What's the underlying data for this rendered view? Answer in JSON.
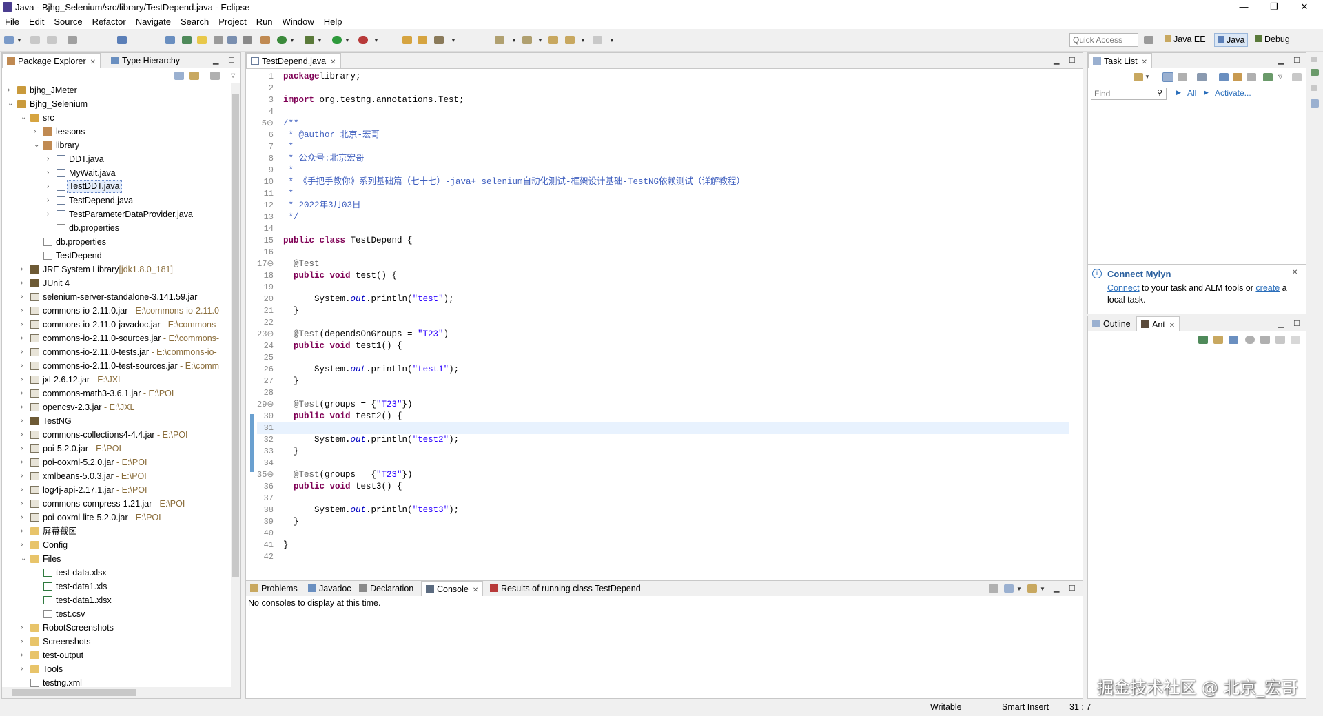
{
  "window": {
    "title": "Java - Bjhg_Selenium/src/library/TestDepend.java - Eclipse",
    "minimize": "—",
    "maximize": "❐",
    "close": "✕"
  },
  "menu": [
    "File",
    "Edit",
    "Source",
    "Refactor",
    "Navigate",
    "Search",
    "Project",
    "Run",
    "Window",
    "Help"
  ],
  "toolbar": {
    "quick_access": "Quick Access",
    "perspectives": [
      "Java EE",
      "Java",
      "Debug"
    ]
  },
  "package_explorer": {
    "tabs": [
      "Package Explorer",
      "Type Hierarchy"
    ],
    "items": [
      {
        "label": "bjhg_JMeter",
        "sub": "",
        "icon": "proj",
        "depth": 0,
        "tw": "›"
      },
      {
        "label": "Bjhg_Selenium",
        "sub": "",
        "icon": "proj",
        "depth": 0,
        "tw": "⌄"
      },
      {
        "label": "src",
        "sub": "",
        "icon": "src",
        "depth": 1,
        "tw": "⌄"
      },
      {
        "label": "lessons",
        "sub": "",
        "icon": "pkg",
        "depth": 2,
        "tw": "›"
      },
      {
        "label": "library",
        "sub": "",
        "icon": "pkg",
        "depth": 2,
        "tw": "⌄"
      },
      {
        "label": "DDT.java",
        "sub": "",
        "icon": "java",
        "depth": 3,
        "tw": "›"
      },
      {
        "label": "MyWait.java",
        "sub": "",
        "icon": "java",
        "depth": 3,
        "tw": "›"
      },
      {
        "label": "TestDDT.java",
        "sub": "",
        "icon": "java",
        "depth": 3,
        "tw": "›",
        "selected": true
      },
      {
        "label": "TestDepend.java",
        "sub": "",
        "icon": "java",
        "depth": 3,
        "tw": "›"
      },
      {
        "label": "TestParameterDataProvider.java",
        "sub": "",
        "icon": "java",
        "depth": 3,
        "tw": "›"
      },
      {
        "label": "db.properties",
        "sub": "",
        "icon": "file",
        "depth": 3,
        "tw": ""
      },
      {
        "label": "db.properties",
        "sub": "",
        "icon": "file",
        "depth": 2,
        "tw": ""
      },
      {
        "label": "TestDepend",
        "sub": "",
        "icon": "file",
        "depth": 2,
        "tw": ""
      },
      {
        "label": "JRE System Library",
        "sub": "[jdk1.8.0_181]",
        "icon": "lib",
        "depth": 1,
        "tw": "›"
      },
      {
        "label": "JUnit 4",
        "sub": "",
        "icon": "lib",
        "depth": 1,
        "tw": "›"
      },
      {
        "label": "selenium-server-standalone-3.141.59.jar",
        "sub": "",
        "icon": "jar",
        "depth": 1,
        "tw": "›"
      },
      {
        "label": "commons-io-2.11.0.jar",
        "sub": " - E:\\commons-io-2.11.0",
        "icon": "jar",
        "depth": 1,
        "tw": "›"
      },
      {
        "label": "commons-io-2.11.0-javadoc.jar",
        "sub": " - E:\\commons-",
        "icon": "jar",
        "depth": 1,
        "tw": "›"
      },
      {
        "label": "commons-io-2.11.0-sources.jar",
        "sub": " - E:\\commons-",
        "icon": "jar",
        "depth": 1,
        "tw": "›"
      },
      {
        "label": "commons-io-2.11.0-tests.jar",
        "sub": " - E:\\commons-io-",
        "icon": "jar",
        "depth": 1,
        "tw": "›"
      },
      {
        "label": "commons-io-2.11.0-test-sources.jar",
        "sub": " - E:\\comm",
        "icon": "jar",
        "depth": 1,
        "tw": "›"
      },
      {
        "label": "jxl-2.6.12.jar",
        "sub": " - E:\\JXL",
        "icon": "jar",
        "depth": 1,
        "tw": "›"
      },
      {
        "label": "commons-math3-3.6.1.jar",
        "sub": " - E:\\POI",
        "icon": "jar",
        "depth": 1,
        "tw": "›"
      },
      {
        "label": "opencsv-2.3.jar",
        "sub": " - E:\\JXL",
        "icon": "jar",
        "depth": 1,
        "tw": "›"
      },
      {
        "label": "TestNG",
        "sub": "",
        "icon": "lib",
        "depth": 1,
        "tw": "›"
      },
      {
        "label": "commons-collections4-4.4.jar",
        "sub": " - E:\\POI",
        "icon": "jar",
        "depth": 1,
        "tw": "›"
      },
      {
        "label": "poi-5.2.0.jar",
        "sub": " - E:\\POI",
        "icon": "jar",
        "depth": 1,
        "tw": "›"
      },
      {
        "label": "poi-ooxml-5.2.0.jar",
        "sub": " - E:\\POI",
        "icon": "jar",
        "depth": 1,
        "tw": "›"
      },
      {
        "label": "xmlbeans-5.0.3.jar",
        "sub": " - E:\\POI",
        "icon": "jar",
        "depth": 1,
        "tw": "›"
      },
      {
        "label": "log4j-api-2.17.1.jar",
        "sub": " - E:\\POI",
        "icon": "jar",
        "depth": 1,
        "tw": "›"
      },
      {
        "label": "commons-compress-1.21.jar",
        "sub": " - E:\\POI",
        "icon": "jar",
        "depth": 1,
        "tw": "›"
      },
      {
        "label": "poi-ooxml-lite-5.2.0.jar",
        "sub": " - E:\\POI",
        "icon": "jar",
        "depth": 1,
        "tw": "›"
      },
      {
        "label": "屏幕截图",
        "sub": "",
        "icon": "folder",
        "depth": 1,
        "tw": "›"
      },
      {
        "label": "Config",
        "sub": "",
        "icon": "folder",
        "depth": 1,
        "tw": "›"
      },
      {
        "label": "Files",
        "sub": "",
        "icon": "folder",
        "depth": 1,
        "tw": "⌄"
      },
      {
        "label": "test-data.xlsx",
        "sub": "",
        "icon": "xls",
        "depth": 2,
        "tw": ""
      },
      {
        "label": "test-data1.xls",
        "sub": "",
        "icon": "xls",
        "depth": 2,
        "tw": ""
      },
      {
        "label": "test-data1.xlsx",
        "sub": "",
        "icon": "xls",
        "depth": 2,
        "tw": ""
      },
      {
        "label": "test.csv",
        "sub": "",
        "icon": "file",
        "depth": 2,
        "tw": ""
      },
      {
        "label": "RobotScreenshots",
        "sub": "",
        "icon": "folder",
        "depth": 1,
        "tw": "›"
      },
      {
        "label": "Screenshots",
        "sub": "",
        "icon": "folder",
        "depth": 1,
        "tw": "›"
      },
      {
        "label": "test-output",
        "sub": "",
        "icon": "folder",
        "depth": 1,
        "tw": "›"
      },
      {
        "label": "Tools",
        "sub": "",
        "icon": "folder",
        "depth": 1,
        "tw": "›"
      },
      {
        "label": "testng.xml",
        "sub": "",
        "icon": "file",
        "depth": 1,
        "tw": ""
      }
    ]
  },
  "editor": {
    "tab": "TestDepend.java",
    "lines": [
      {
        "n": "1",
        "t": [
          [
            "kw",
            "package"
          ],
          [
            "",
            "library;"
          ]
        ]
      },
      {
        "n": "2",
        "t": []
      },
      {
        "n": "3",
        "t": [
          [
            "kw",
            "import"
          ],
          [
            "",
            " org.testng.annotations.Test;"
          ]
        ]
      },
      {
        "n": "4",
        "t": []
      },
      {
        "n": "5⊖",
        "t": [
          [
            "cm",
            "/**"
          ]
        ]
      },
      {
        "n": "6",
        "t": [
          [
            "cm",
            " * @author 北京-宏哥"
          ]
        ]
      },
      {
        "n": "7",
        "t": [
          [
            "cm",
            " *"
          ]
        ]
      },
      {
        "n": "8",
        "t": [
          [
            "cm",
            " * 公众号:北京宏哥"
          ]
        ]
      },
      {
        "n": "9",
        "t": [
          [
            "cm",
            " *"
          ]
        ]
      },
      {
        "n": "10",
        "t": [
          [
            "cm",
            " * 《手把手教你》系列基础篇（七十七）-java+ selenium自动化测试-框架设计基础-TestNG依赖测试（详解教程）"
          ]
        ]
      },
      {
        "n": "11",
        "t": [
          [
            "cm",
            " *"
          ]
        ]
      },
      {
        "n": "12",
        "t": [
          [
            "cm",
            " * 2022年3月03日"
          ]
        ]
      },
      {
        "n": "13",
        "t": [
          [
            "cm",
            " */"
          ]
        ]
      },
      {
        "n": "14",
        "t": []
      },
      {
        "n": "15",
        "t": [
          [
            "kw",
            "public class"
          ],
          [
            "",
            " TestDepend {"
          ]
        ]
      },
      {
        "n": "16",
        "t": []
      },
      {
        "n": "17⊖",
        "t": [
          [
            "an",
            "  @Test"
          ]
        ]
      },
      {
        "n": "18",
        "t": [
          [
            "kw",
            "  public void"
          ],
          [
            "",
            " test() {"
          ]
        ]
      },
      {
        "n": "19",
        "t": []
      },
      {
        "n": "20",
        "t": [
          [
            "",
            "      System."
          ],
          [
            "fd",
            "out"
          ],
          [
            "",
            ".println("
          ],
          [
            "st",
            "\"test\""
          ],
          [
            "",
            ");"
          ]
        ]
      },
      {
        "n": "21",
        "t": [
          [
            "",
            "  }"
          ]
        ]
      },
      {
        "n": "22",
        "t": []
      },
      {
        "n": "23⊖",
        "t": [
          [
            "an",
            "  @Test"
          ],
          [
            "",
            "(dependsOnGroups = "
          ],
          [
            "st",
            "\"T23\""
          ],
          [
            "",
            ")"
          ]
        ]
      },
      {
        "n": "24",
        "t": [
          [
            "kw",
            "  public void"
          ],
          [
            "",
            " test1() {"
          ]
        ]
      },
      {
        "n": "25",
        "t": []
      },
      {
        "n": "26",
        "t": [
          [
            "",
            "      System."
          ],
          [
            "fd",
            "out"
          ],
          [
            "",
            ".println("
          ],
          [
            "st",
            "\"test1\""
          ],
          [
            "",
            ");"
          ]
        ]
      },
      {
        "n": "27",
        "t": [
          [
            "",
            "  }"
          ]
        ]
      },
      {
        "n": "28",
        "t": []
      },
      {
        "n": "29⊖",
        "t": [
          [
            "an",
            "  @Test"
          ],
          [
            "",
            "(groups = {"
          ],
          [
            "st",
            "\"T23\""
          ],
          [
            "",
            "})"
          ]
        ]
      },
      {
        "n": "30",
        "t": [
          [
            "kw",
            "  public void"
          ],
          [
            "",
            " test2() {"
          ]
        ]
      },
      {
        "n": "31",
        "t": [],
        "current": true
      },
      {
        "n": "32",
        "t": [
          [
            "",
            "      System."
          ],
          [
            "fd",
            "out"
          ],
          [
            "",
            ".println("
          ],
          [
            "st",
            "\"test2\""
          ],
          [
            "",
            ");"
          ]
        ]
      },
      {
        "n": "33",
        "t": [
          [
            "",
            "  }"
          ]
        ]
      },
      {
        "n": "34",
        "t": []
      },
      {
        "n": "35⊖",
        "t": [
          [
            "an",
            "  @Test"
          ],
          [
            "",
            "(groups = {"
          ],
          [
            "st",
            "\"T23\""
          ],
          [
            "",
            "})"
          ]
        ]
      },
      {
        "n": "36",
        "t": [
          [
            "kw",
            "  public void"
          ],
          [
            "",
            " test3() {"
          ]
        ]
      },
      {
        "n": "37",
        "t": []
      },
      {
        "n": "38",
        "t": [
          [
            "",
            "      System."
          ],
          [
            "fd",
            "out"
          ],
          [
            "",
            ".println("
          ],
          [
            "st",
            "\"test3\""
          ],
          [
            "",
            ");"
          ]
        ]
      },
      {
        "n": "39",
        "t": [
          [
            "",
            "  }"
          ]
        ]
      },
      {
        "n": "40",
        "t": []
      },
      {
        "n": "41",
        "t": [
          [
            "",
            "}"
          ]
        ]
      },
      {
        "n": "42",
        "t": []
      }
    ]
  },
  "task_list": {
    "tab": "Task List",
    "find_placeholder": "Find",
    "all": "All",
    "activate": "Activate..."
  },
  "mylyn": {
    "title": "Connect Mylyn",
    "connect": "Connect",
    "text1": " to your task and ALM tools or ",
    "create": "create",
    "text2": " a",
    "text3": "local task."
  },
  "outline": {
    "tabs": [
      "Outline",
      "Ant"
    ]
  },
  "bottom": {
    "tabs": [
      "Problems",
      "Javadoc",
      "Declaration",
      "Console",
      "Results of running class TestDepend"
    ],
    "message": "No consoles to display at this time."
  },
  "status": {
    "writable": "Writable",
    "insert": "Smart Insert",
    "position": "31 : 7"
  },
  "watermark": "掘金技术社区 @ 北京_宏哥",
  "colors": {
    "keyword": "#7f0055",
    "comment": "#3f5fbf",
    "string": "#2a00ff",
    "current_line": "#e8f2fe",
    "link": "#2a6ebb"
  }
}
